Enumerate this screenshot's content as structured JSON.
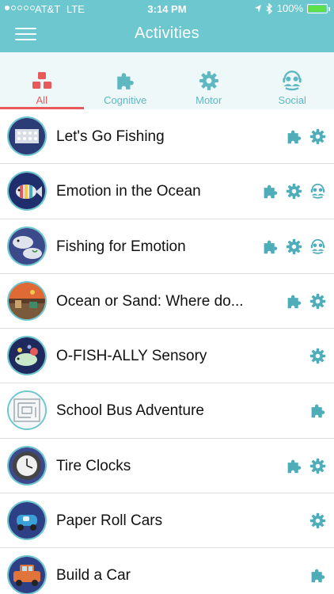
{
  "status": {
    "carrier": "AT&T",
    "network": "LTE",
    "time": "3:14 PM",
    "battery_text": "100%",
    "battery_level": 1.0,
    "signal_bars_filled": 1,
    "signal_bars_total": 5
  },
  "nav": {
    "title": "Activities",
    "menu_icon": "hamburger-menu-icon"
  },
  "colors": {
    "header": "#6cc7cf",
    "accent": "#5fb7c1",
    "active_tab": "#e85a5a",
    "tab_bar_bg": "#eef8f9",
    "icon": "#4eadb9"
  },
  "tabs": [
    {
      "label": "All",
      "icon": "blocks-icon",
      "active": true
    },
    {
      "label": "Cognitive",
      "icon": "puzzle-icon",
      "active": false
    },
    {
      "label": "Motor",
      "icon": "gear-icon",
      "active": false
    },
    {
      "label": "Social",
      "icon": "people-icon",
      "active": false
    }
  ],
  "activities": [
    {
      "title": "Let's Go Fishing",
      "icons": [
        "puzzle-icon",
        "gear-icon"
      ],
      "thumb": "fishing-board"
    },
    {
      "title": "Emotion in the Ocean",
      "icons": [
        "puzzle-icon",
        "gear-icon",
        "people-icon"
      ],
      "thumb": "rainbow-fish"
    },
    {
      "title": "Fishing for Emotion",
      "icons": [
        "puzzle-icon",
        "gear-icon",
        "people-icon"
      ],
      "thumb": "paper-fish"
    },
    {
      "title": "Ocean or Sand: Where do...",
      "icons": [
        "puzzle-icon",
        "gear-icon"
      ],
      "thumb": "sand-scene"
    },
    {
      "title": "O-FISH-ALLY Sensory",
      "icons": [
        "gear-icon"
      ],
      "thumb": "sensory-fish"
    },
    {
      "title": "School Bus Adventure",
      "icons": [
        "puzzle-icon"
      ],
      "thumb": "maze"
    },
    {
      "title": "Tire Clocks",
      "icons": [
        "puzzle-icon",
        "gear-icon"
      ],
      "thumb": "tire-clock"
    },
    {
      "title": "Paper Roll Cars",
      "icons": [
        "gear-icon"
      ],
      "thumb": "paper-car"
    },
    {
      "title": "Build a Car",
      "icons": [
        "puzzle-icon"
      ],
      "thumb": "orange-car"
    }
  ]
}
